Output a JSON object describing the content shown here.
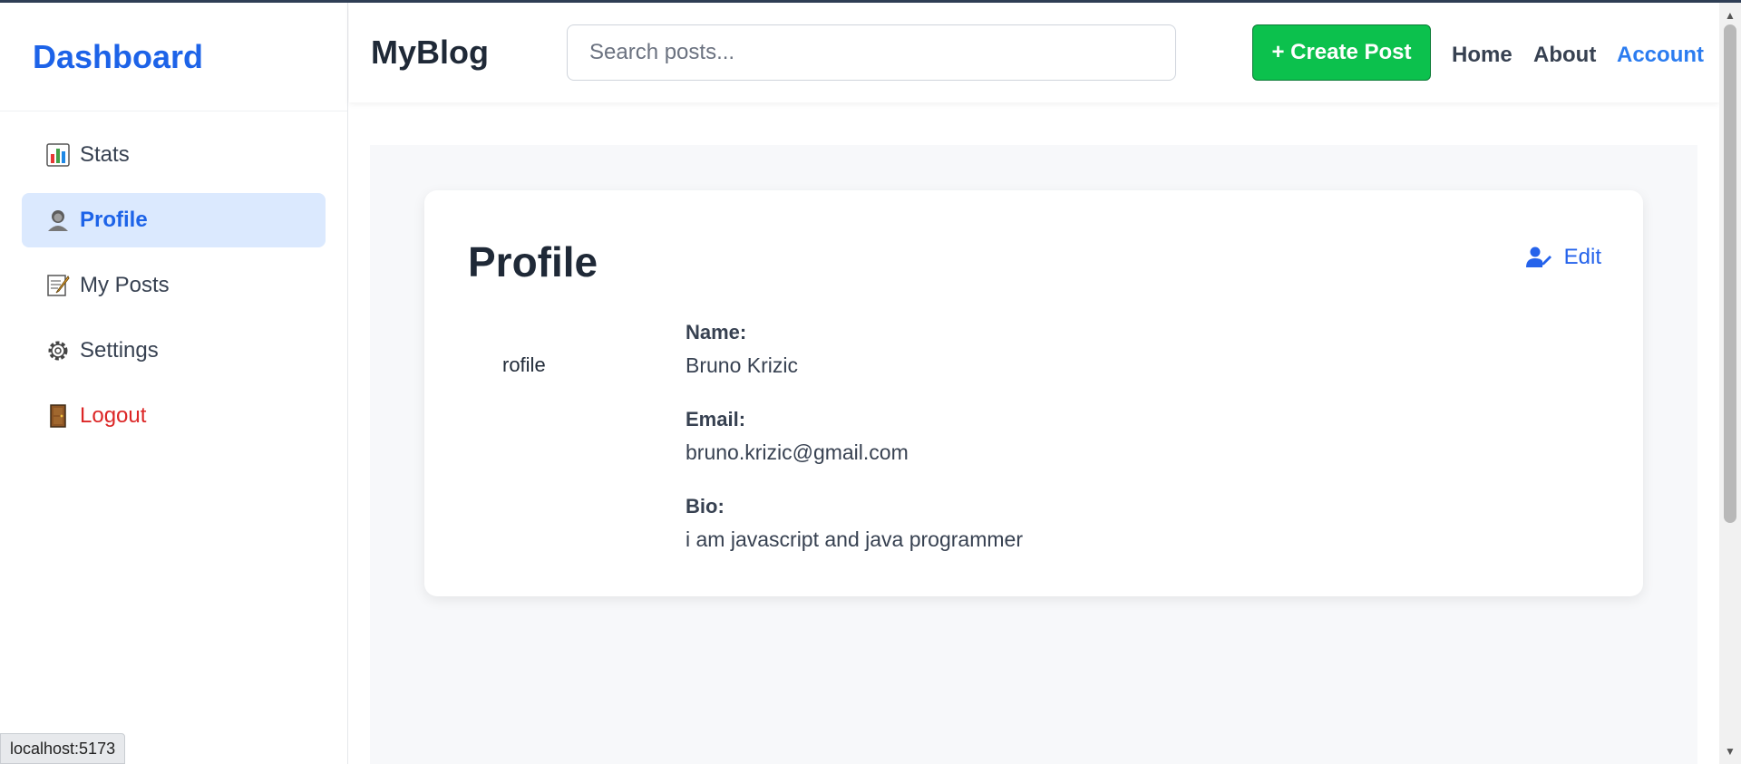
{
  "sidebar": {
    "title": "Dashboard",
    "items": [
      {
        "label": "Stats",
        "icon": "bar-chart-icon"
      },
      {
        "label": "Profile",
        "icon": "user-icon",
        "active": true
      },
      {
        "label": "My Posts",
        "icon": "memo-icon"
      },
      {
        "label": "Settings",
        "icon": "gear-icon"
      },
      {
        "label": "Logout",
        "icon": "door-icon"
      }
    ]
  },
  "header": {
    "brand": "MyBlog",
    "search_placeholder": "Search posts...",
    "create_label": "+ Create Post",
    "links": [
      "Home",
      "About",
      "Account"
    ]
  },
  "profile": {
    "title": "Profile",
    "edit_label": "Edit",
    "avatar_alt": "rofile",
    "name_label": "Name:",
    "name": "Bruno Krizic",
    "email_label": "Email:",
    "email": "bruno.krizic@gmail.com",
    "bio_label": "Bio:",
    "bio": "i am javascript and java programmer"
  },
  "status_url": "localhost:5173",
  "colors": {
    "accent": "#1d63e8",
    "create_button": "#0cc14d",
    "logout": "#dc2626",
    "active_bg": "#dbe9fe"
  }
}
